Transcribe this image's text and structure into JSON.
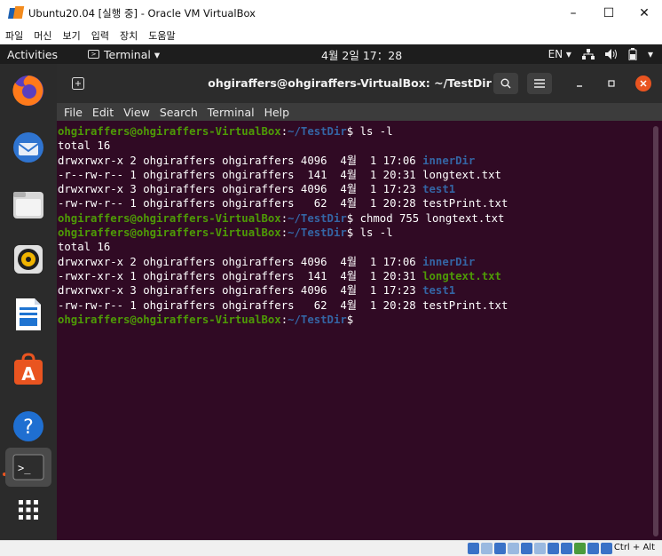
{
  "window": {
    "title": "Ubuntu20.04 [실행 중] - Oracle VM VirtualBox",
    "controls": [
      "–",
      "☐",
      "✕"
    ]
  },
  "host_menu": [
    "파일",
    "머신",
    "보기",
    "입력",
    "장치",
    "도움말"
  ],
  "topbar": {
    "activities": "Activities",
    "app": "Terminal ▾",
    "app_icon": "terminal-icon",
    "clock": "4월 2일 17：28",
    "lang": "EN ▾",
    "status_icons": [
      "network-icon",
      "volume-icon",
      "battery-icon",
      "power-menu-icon"
    ]
  },
  "dock": [
    "firefox",
    "thunderbird",
    "files",
    "rhythmbox",
    "libreoffice-writer",
    "ubuntu-software",
    "help",
    "terminal",
    "show-applications"
  ],
  "terminal": {
    "title": "ohgiraffers@ohgiraffers-VirtualBox: ~/TestDir",
    "menu": [
      "File",
      "Edit",
      "View",
      "Search",
      "Terminal",
      "Help"
    ],
    "prompt_user": "ohgiraffers@ohgiraffers-VirtualBox",
    "prompt_path": "~/TestDir",
    "lines": [
      {
        "type": "cmd",
        "cmd": "ls -l"
      },
      {
        "type": "out",
        "text": "total 16"
      },
      {
        "type": "ls",
        "pre": "drwxrwxr-x 2 ohgiraffers ohgiraffers 4096  4월  1 17:06 ",
        "name": "innerDir",
        "kind": "dir"
      },
      {
        "type": "ls",
        "pre": "-r--rw-r-- 1 ohgiraffers ohgiraffers  141  4월  1 20:31 ",
        "name": "longtext.txt",
        "kind": "file"
      },
      {
        "type": "ls",
        "pre": "drwxrwxr-x 3 ohgiraffers ohgiraffers 4096  4월  1 17:23 ",
        "name": "test1",
        "kind": "dir"
      },
      {
        "type": "ls",
        "pre": "-rw-rw-r-- 1 ohgiraffers ohgiraffers   62  4월  1 20:28 ",
        "name": "testPrint.txt",
        "kind": "file"
      },
      {
        "type": "cmd",
        "cmd": "chmod 755 longtext.txt"
      },
      {
        "type": "cmd",
        "cmd": "ls -l"
      },
      {
        "type": "out",
        "text": "total 16"
      },
      {
        "type": "ls",
        "pre": "drwxrwxr-x 2 ohgiraffers ohgiraffers 4096  4월  1 17:06 ",
        "name": "innerDir",
        "kind": "dir"
      },
      {
        "type": "ls",
        "pre": "-rwxr-xr-x 1 ohgiraffers ohgiraffers  141  4월  1 20:31 ",
        "name": "longtext.txt",
        "kind": "exe"
      },
      {
        "type": "ls",
        "pre": "drwxrwxr-x 3 ohgiraffers ohgiraffers 4096  4월  1 17:23 ",
        "name": "test1",
        "kind": "dir"
      },
      {
        "type": "ls",
        "pre": "-rw-rw-r-- 1 ohgiraffers ohgiraffers   62  4월  1 20:28 ",
        "name": "testPrint.txt",
        "kind": "file"
      },
      {
        "type": "cmd",
        "cmd": ""
      }
    ]
  },
  "statusbar": {
    "hostkey": "Ctrl + Alt"
  },
  "colors": {
    "terminal_bg": "#300a24",
    "prompt_user": "#4e9a06",
    "prompt_path": "#3465a4",
    "accent": "#e95420"
  }
}
